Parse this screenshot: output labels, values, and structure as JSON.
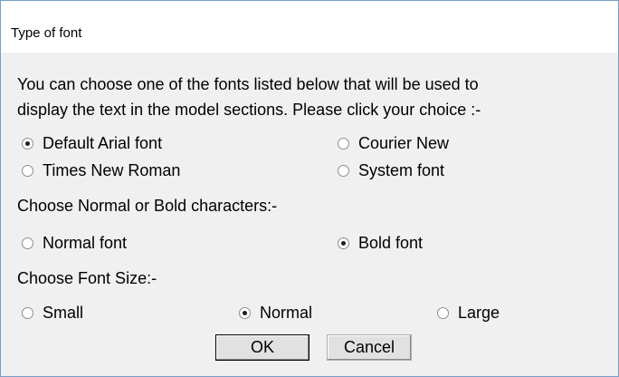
{
  "window": {
    "title": "Type of font"
  },
  "intro": {
    "line1": "You can choose one of the fonts listed below that will be used to",
    "line2": "display the text in the model sections. Please click your choice :-"
  },
  "font_type": {
    "options": [
      {
        "label": "Default Arial font",
        "selected": true
      },
      {
        "label": "Courier New",
        "selected": false
      },
      {
        "label": "Times New Roman",
        "selected": false
      },
      {
        "label": "System font",
        "selected": false
      }
    ]
  },
  "weight": {
    "heading": "Choose Normal or Bold characters:-",
    "options": [
      {
        "label": "Normal font",
        "selected": false
      },
      {
        "label": "Bold font",
        "selected": true
      }
    ]
  },
  "size": {
    "heading": "Choose Font Size:-",
    "options": [
      {
        "label": "Small",
        "selected": false
      },
      {
        "label": "Normal",
        "selected": true
      },
      {
        "label": "Large",
        "selected": false
      }
    ]
  },
  "buttons": {
    "ok": "OK",
    "cancel": "Cancel"
  }
}
